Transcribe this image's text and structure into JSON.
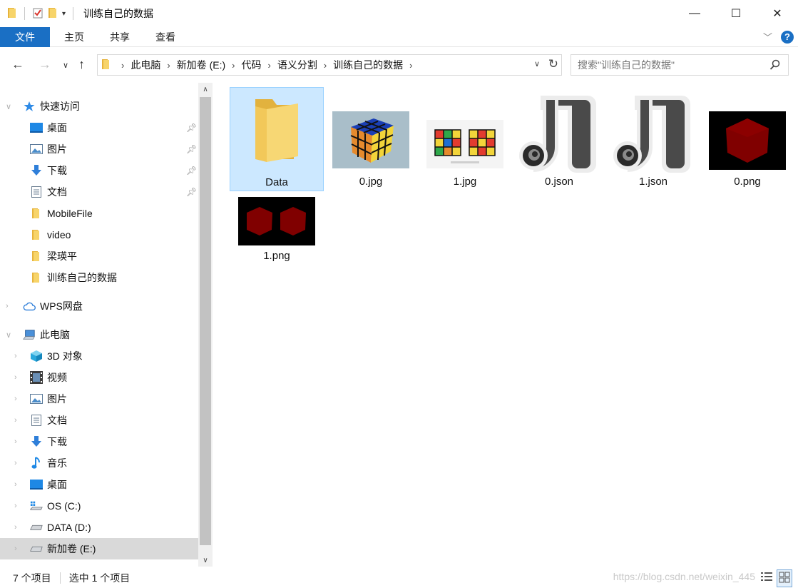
{
  "window": {
    "title": "训练自己的数据",
    "controls": {
      "minimize": "—",
      "maximize": "☐",
      "close": "✕"
    }
  },
  "ribbon": {
    "file_tab": "文件",
    "tabs": [
      "主页",
      "共享",
      "查看"
    ]
  },
  "address": {
    "crumbs": [
      "此电脑",
      "新加卷 (E:)",
      "代码",
      "语义分割",
      "训练自己的数据"
    ],
    "search_placeholder": "搜索\"训练自己的数据\""
  },
  "sidebar": {
    "quick_access": "快速访问",
    "quick_items": [
      {
        "label": "桌面",
        "icon": "desktop-icon",
        "pinned": true
      },
      {
        "label": "图片",
        "icon": "pictures-icon",
        "pinned": true
      },
      {
        "label": "下载",
        "icon": "download-icon",
        "pinned": true
      },
      {
        "label": "文档",
        "icon": "documents-icon",
        "pinned": true
      },
      {
        "label": "MobileFile",
        "icon": "folder-icon",
        "pinned": false
      },
      {
        "label": "video",
        "icon": "folder-icon",
        "pinned": false
      },
      {
        "label": "梁瑛平",
        "icon": "folder-icon",
        "pinned": false
      },
      {
        "label": "训练自己的数据",
        "icon": "folder-icon",
        "pinned": false
      }
    ],
    "wps": "WPS网盘",
    "this_pc": "此电脑",
    "pc_items": [
      {
        "label": "3D 对象",
        "icon": "3d-objects-icon"
      },
      {
        "label": "视频",
        "icon": "video-icon"
      },
      {
        "label": "图片",
        "icon": "pictures-icon"
      },
      {
        "label": "文档",
        "icon": "documents-icon"
      },
      {
        "label": "下载",
        "icon": "download-icon"
      },
      {
        "label": "音乐",
        "icon": "music-icon"
      },
      {
        "label": "桌面",
        "icon": "desktop-icon"
      },
      {
        "label": "OS (C:)",
        "icon": "drive-c-icon"
      },
      {
        "label": "DATA (D:)",
        "icon": "drive-icon"
      },
      {
        "label": "新加卷 (E:)",
        "icon": "drive-icon"
      }
    ]
  },
  "files": [
    {
      "name": "Data",
      "type": "folder"
    },
    {
      "name": "0.jpg",
      "type": "jpg"
    },
    {
      "name": "1.jpg",
      "type": "jpg"
    },
    {
      "name": "0.json",
      "type": "json"
    },
    {
      "name": "1.json",
      "type": "json"
    },
    {
      "name": "0.png",
      "type": "png"
    },
    {
      "name": "1.png",
      "type": "png"
    }
  ],
  "status": {
    "count": "7 个项目",
    "selected": "选中 1 个项目",
    "watermark": "https://blog.csdn.net/weixin_445"
  },
  "colors": {
    "accent": "#1a6fc4",
    "selection": "#cce8ff",
    "folder": "#f5c95b"
  }
}
